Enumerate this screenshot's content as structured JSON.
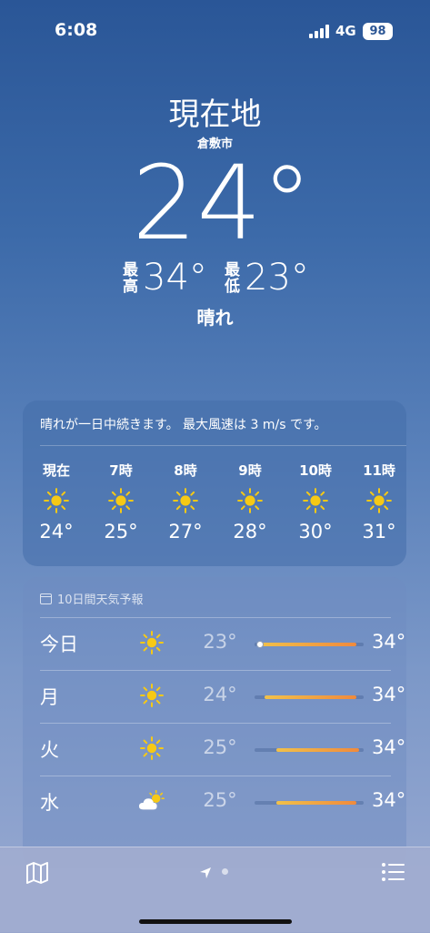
{
  "status": {
    "time": "6:08",
    "network": "4G",
    "battery": "98"
  },
  "header": {
    "location": "現在地",
    "city": "倉敷市",
    "temperature": "24°",
    "high_label_1": "最",
    "high_label_2": "高",
    "high_value": "34°",
    "low_label_1": "最",
    "low_label_2": "低",
    "low_value": "23°",
    "condition": "晴れ"
  },
  "hourly": {
    "summary": "晴れが一日中続きます。 最大風速は 3 m/s です。",
    "items": [
      {
        "time": "現在",
        "icon": "sun-icon",
        "temp": "24°"
      },
      {
        "time": "7時",
        "icon": "sun-icon",
        "temp": "25°"
      },
      {
        "time": "8時",
        "icon": "sun-icon",
        "temp": "27°"
      },
      {
        "time": "9時",
        "icon": "sun-icon",
        "temp": "28°"
      },
      {
        "time": "10時",
        "icon": "sun-icon",
        "temp": "30°"
      },
      {
        "time": "11時",
        "icon": "sun-icon",
        "temp": "31°"
      }
    ]
  },
  "daily": {
    "title": "10日間天気予報",
    "items": [
      {
        "day": "今日",
        "icon": "sun-icon",
        "low": "23°",
        "high": "34°",
        "range_start": 0.03,
        "range_end": 0.93,
        "current": 0.05
      },
      {
        "day": "月",
        "icon": "sun-icon",
        "low": "24°",
        "high": "34°",
        "range_start": 0.09,
        "range_end": 0.93
      },
      {
        "day": "火",
        "icon": "sun-icon",
        "low": "25°",
        "high": "34°",
        "range_start": 0.2,
        "range_end": 0.96
      },
      {
        "day": "水",
        "icon": "partly-cloudy-icon",
        "low": "25°",
        "high": "34°",
        "range_start": 0.2,
        "range_end": 0.93
      }
    ]
  },
  "toolbar": {
    "map_icon": "map-icon",
    "location_icon": "location-arrow-icon",
    "list_icon": "list-icon"
  },
  "colors": {
    "sun": "#f6c915",
    "bar_start": "#f1c14a",
    "bar_end": "#f08a3c"
  }
}
